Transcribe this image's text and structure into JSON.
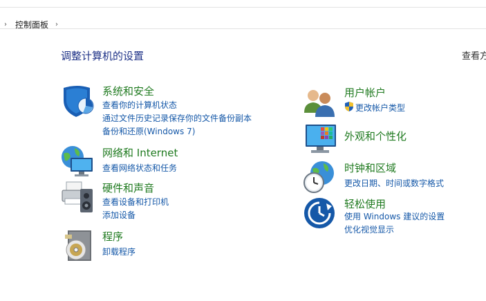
{
  "breadcrumb": {
    "location": "控制面板"
  },
  "page": {
    "title": "调整计算机的设置",
    "view_by": "查看方式"
  },
  "categories": {
    "system": {
      "title": "系统和安全",
      "links": [
        "查看你的计算机状态",
        "通过文件历史记录保存你的文件备份副本",
        "备份和还原(Windows 7)"
      ],
      "icon": "system-security-shield-icon"
    },
    "network": {
      "title": "网络和 Internet",
      "links": [
        "查看网络状态和任务"
      ],
      "icon": "network-globe-icon"
    },
    "hardware": {
      "title": "硬件和声音",
      "links": [
        "查看设备和打印机",
        "添加设备"
      ],
      "icon": "printer-speaker-icon"
    },
    "programs": {
      "title": "程序",
      "links": [
        "卸载程序"
      ],
      "icon": "programs-disk-icon"
    },
    "users": {
      "title": "用户帐户",
      "links": [
        "更改帐户类型"
      ],
      "icon": "users-icon"
    },
    "appearance": {
      "title": "外观和个性化",
      "links": [],
      "icon": "monitor-palette-icon"
    },
    "clock": {
      "title": "时钟和区域",
      "links": [
        "更改日期、时间或数字格式"
      ],
      "icon": "clock-globe-icon"
    },
    "ease": {
      "title": "轻松使用",
      "links": [
        "使用 Windows 建议的设置",
        "优化视觉显示"
      ],
      "icon": "ease-of-access-icon"
    }
  },
  "colors": {
    "title_blue": "#1e3287",
    "category_green": "#1f7a1f",
    "link_blue": "#1558a8"
  }
}
